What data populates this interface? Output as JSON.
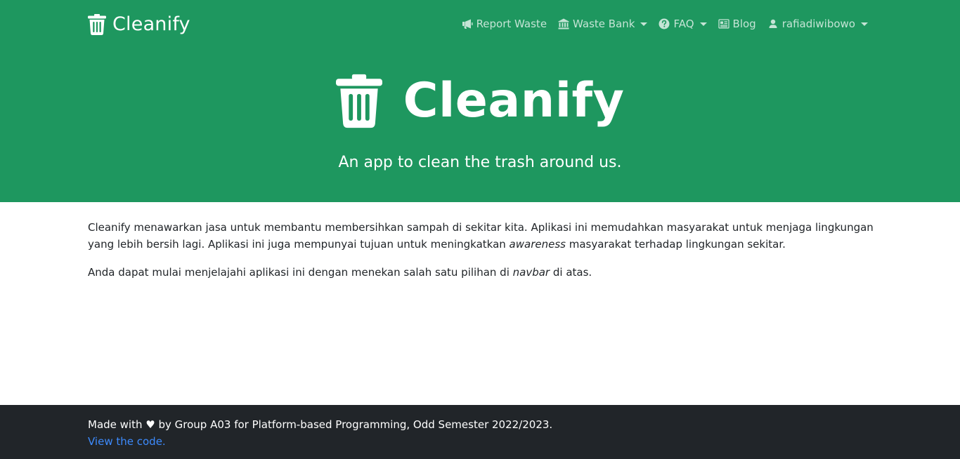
{
  "brand": {
    "name": "Cleanify",
    "icon": "trash-icon"
  },
  "nav": {
    "report_waste": "Report Waste",
    "waste_bank": "Waste Bank",
    "faq": "FAQ",
    "blog": "Blog",
    "user": "rafiadiwibowo"
  },
  "hero": {
    "title": "Cleanify",
    "subtitle": "An app to clean the trash around us."
  },
  "content": {
    "p1_a": "Cleanify menawarkan jasa untuk membantu membersihkan sampah di sekitar kita. Aplikasi ini memudahkan masyarakat untuk menjaga lingkungan yang lebih bersih lagi. Aplikasi ini juga mempunyai tujuan untuk meningkatkan ",
    "p1_em": "awareness",
    "p1_b": " masyarakat terhadap lingkungan sekitar.",
    "p2_a": "Anda dapat mulai menjelajahi aplikasi ini dengan menekan salah satu pilihan di ",
    "p2_em": "navbar",
    "p2_b": " di atas."
  },
  "footer": {
    "text_a": "Made with ",
    "heart": "♥",
    "text_b": " by Group A03 for Platform-based Programming, Odd Semester 2022/2023.",
    "link": "View the code."
  },
  "colors": {
    "primary": "#1e975f",
    "footer_bg": "#212529",
    "link": "#3d8bfd"
  }
}
